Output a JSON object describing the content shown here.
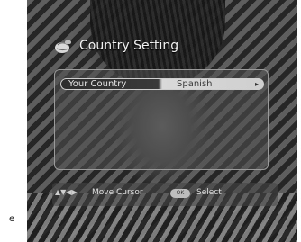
{
  "osd": {
    "title": "Country Setting",
    "title_icon": "globe-icon",
    "setting": {
      "label": "Your Country",
      "value": "Spanish"
    },
    "help": {
      "arrows_icon": "direction-arrows-icon",
      "move": "Move Cursor",
      "ok_label": "OK",
      "select": "Select"
    }
  },
  "page_marker": "e"
}
